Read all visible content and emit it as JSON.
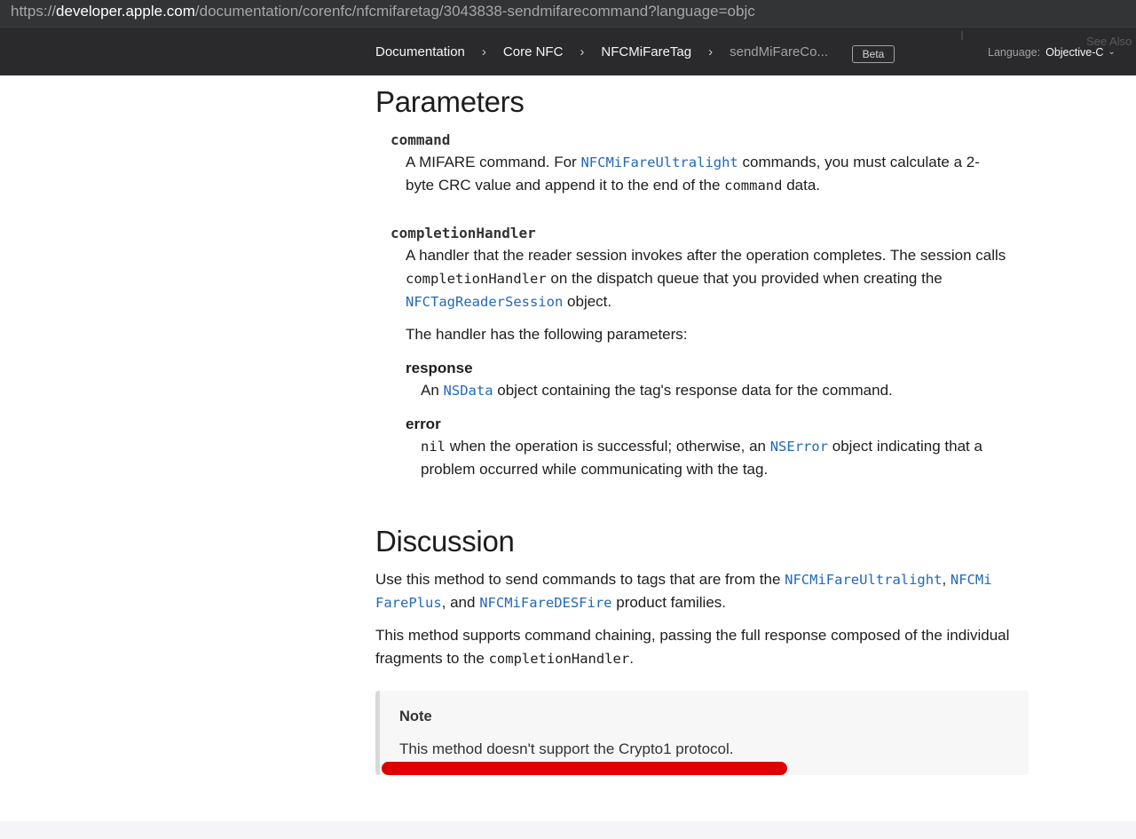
{
  "url": {
    "scheme": "https://",
    "host": "developer.apple.com",
    "path": "/documentation/corenfc/nfcmifaretag/3043838-sendmifarecommand?language=objc"
  },
  "nav": {
    "breadcrumbs": [
      "Documentation",
      "Core NFC",
      "NFCMiFareTag",
      "sendMiFareCo..."
    ],
    "badge": "Beta",
    "language_label": "Language:",
    "language_value": "Objective-C",
    "see_also": "See Also"
  },
  "parameters": {
    "heading": "Parameters",
    "command": {
      "name": "command",
      "desc_1": "A MIFARE command. For ",
      "link_1": "NFCMiFareUltralight",
      "desc_2": " commands, you must calculate a 2-",
      "desc_3": "byte CRC value and append it to the end of the ",
      "code_1": "command",
      "desc_4": " data."
    },
    "completion": {
      "name": "completionHandler",
      "line_1": "A handler that the reader session invokes after the operation completes. The session calls",
      "code_1": "completionHandler",
      "line_2": " on the dispatch queue that you provided when creating the",
      "link_1": "NFCTagReaderSession",
      "line_3": " object.",
      "intro": "The handler has the following parameters:",
      "response_name": "response",
      "response_1": "An ",
      "response_link": "NSData",
      "response_2": " object containing the tag's response data for the command.",
      "error_name": "error",
      "error_code": "nil",
      "error_1": " when the operation is successful; otherwise, an ",
      "error_link": "NSError",
      "error_2": " object indicating that a",
      "error_3": "problem occurred while communicating with the tag."
    }
  },
  "discussion": {
    "heading": "Discussion",
    "p1_1": "Use this method to send commands to tags that are from the ",
    "p1_link1": "NFCMiFareUltralight",
    "p1_2": ", ",
    "p1_link2a": "NFCMi",
    "p1_link2b": "FarePlus",
    "p1_3": ", and ",
    "p1_link3": "NFCMiFareDESFire",
    "p1_4": " product families.",
    "p2_1": "This method supports command chaining, passing the full response composed of the individual",
    "p2_2": "fragments to the ",
    "p2_code": "completionHandler",
    "p2_3": "."
  },
  "note": {
    "title": "Note",
    "body": "This method doesn't support the Crypto1 protocol."
  },
  "colors": {
    "link": "#2269b9",
    "nav_bg": "#2a2a2c",
    "highlight": "#e00000"
  }
}
